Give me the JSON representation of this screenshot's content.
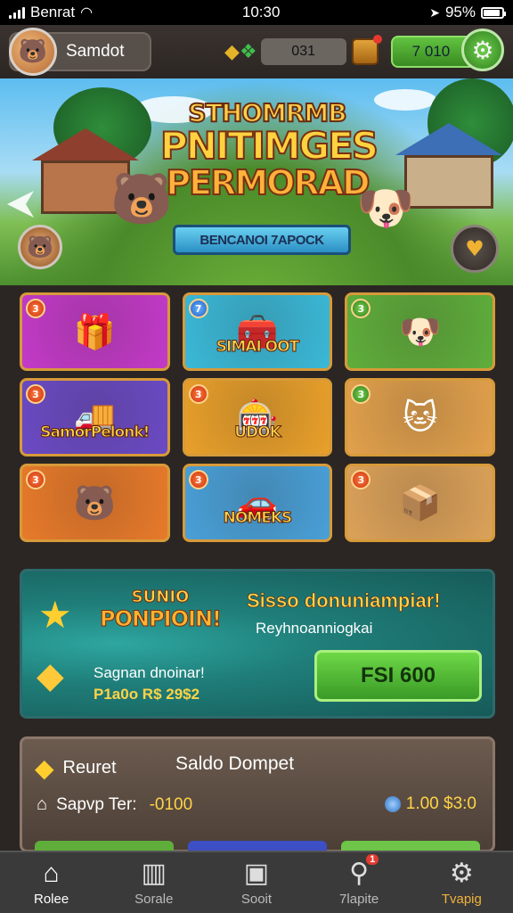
{
  "status_bar": {
    "carrier": "Benrat",
    "time": "10:30",
    "battery_text": "95%"
  },
  "header": {
    "username": "Samdot",
    "gem_count": "031",
    "green_value": "7  010"
  },
  "banner": {
    "title_line1": "STHOMRMB",
    "title_line2": "PNITIMGES",
    "title_line3": "PERMORAD",
    "subtitle": "BENCANOI 7APOCK"
  },
  "cards": [
    {
      "badge": "3",
      "label": "",
      "art": "🎁",
      "bg": "#c33ac8"
    },
    {
      "badge": "7",
      "label": "SIMAI OOT",
      "art": "🧰",
      "bg": "#3ab9d8"
    },
    {
      "badge": "3",
      "label": "",
      "art": "🐶",
      "bg": "#5fae3b"
    },
    {
      "badge": "3",
      "label": "SamorPelonk!",
      "art": "🚚",
      "bg": "#6b4ac4"
    },
    {
      "badge": "3",
      "label": "UDOK",
      "art": "🎰",
      "bg": "#e9a02a"
    },
    {
      "badge": "3",
      "label": "",
      "art": "🐱",
      "bg": "#e2a14c"
    },
    {
      "badge": "3",
      "label": "",
      "art": "🐻",
      "bg": "#e87a2a"
    },
    {
      "badge": "3",
      "label": "NOMEKS",
      "art": "🚗",
      "bg": "#49a0d8"
    },
    {
      "badge": "3",
      "label": "",
      "art": "📦",
      "bg": "#dca259"
    }
  ],
  "promo": {
    "logo_line1": "SUNIO",
    "logo_line2": "PONPIOIN!",
    "heading": "Sisso donuniampiar!",
    "subheading": "Reyhnoanniogkai",
    "small1": "Sagnan dnoinar!",
    "small2": "P1a0o R$ 29$2",
    "button": "FSI 600"
  },
  "wallet": {
    "tag": "Reuret",
    "title": "Saldo Dompet",
    "row_label": "Sapvp Ter:",
    "row_value": "-0100",
    "balance": "1.00 $3:0"
  },
  "bottom_nav": [
    {
      "label": "Rolee",
      "icon": "home-icon"
    },
    {
      "label": "Sorale",
      "icon": "cards-icon"
    },
    {
      "label": "Sooit",
      "icon": "backpack-icon"
    },
    {
      "label": "7lapite",
      "icon": "search-icon",
      "badge": "1"
    },
    {
      "label": "Tvapig",
      "icon": "gear-icon"
    }
  ],
  "colors": {
    "accent_green": "#3a9a26",
    "gold": "#ffd447",
    "teal_panel": "#1f7d78"
  }
}
